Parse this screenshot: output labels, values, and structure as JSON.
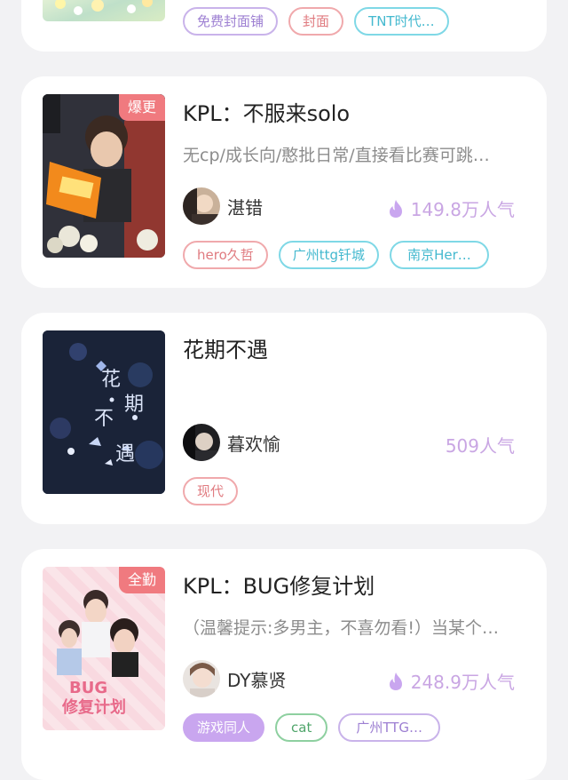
{
  "top_card": {
    "tags": [
      "免费封面铺",
      "封面",
      "TNT时代…"
    ]
  },
  "books": [
    {
      "badge": "爆更",
      "title": "KPL：不服来solo",
      "desc": "无cp/成长向/憨批日常/直接看比赛可跳…",
      "author": "湛错",
      "popularity": "149.8万人气",
      "tags": [
        "hero久哲",
        "广州ttg钎城",
        "南京Her…"
      ]
    },
    {
      "badge": "",
      "title": "花期不遇",
      "desc": "",
      "author": "暮欢愉",
      "popularity": "509人气",
      "tags": [
        "现代"
      ]
    },
    {
      "badge": "全勤",
      "title": "KPL：BUG修复计划",
      "desc": "（温馨提示:多男主，不喜勿看!）当某个…",
      "author": "DY慕贤",
      "popularity": "248.9万人气",
      "tags": [
        "游戏同人",
        "cat",
        "广州TTG…"
      ]
    }
  ],
  "colors": {
    "accent_purple": "#c9a6e3",
    "badge_red": "#f07a7f",
    "tag_pink": "#e07b80",
    "tag_cyan": "#44b9cf"
  }
}
